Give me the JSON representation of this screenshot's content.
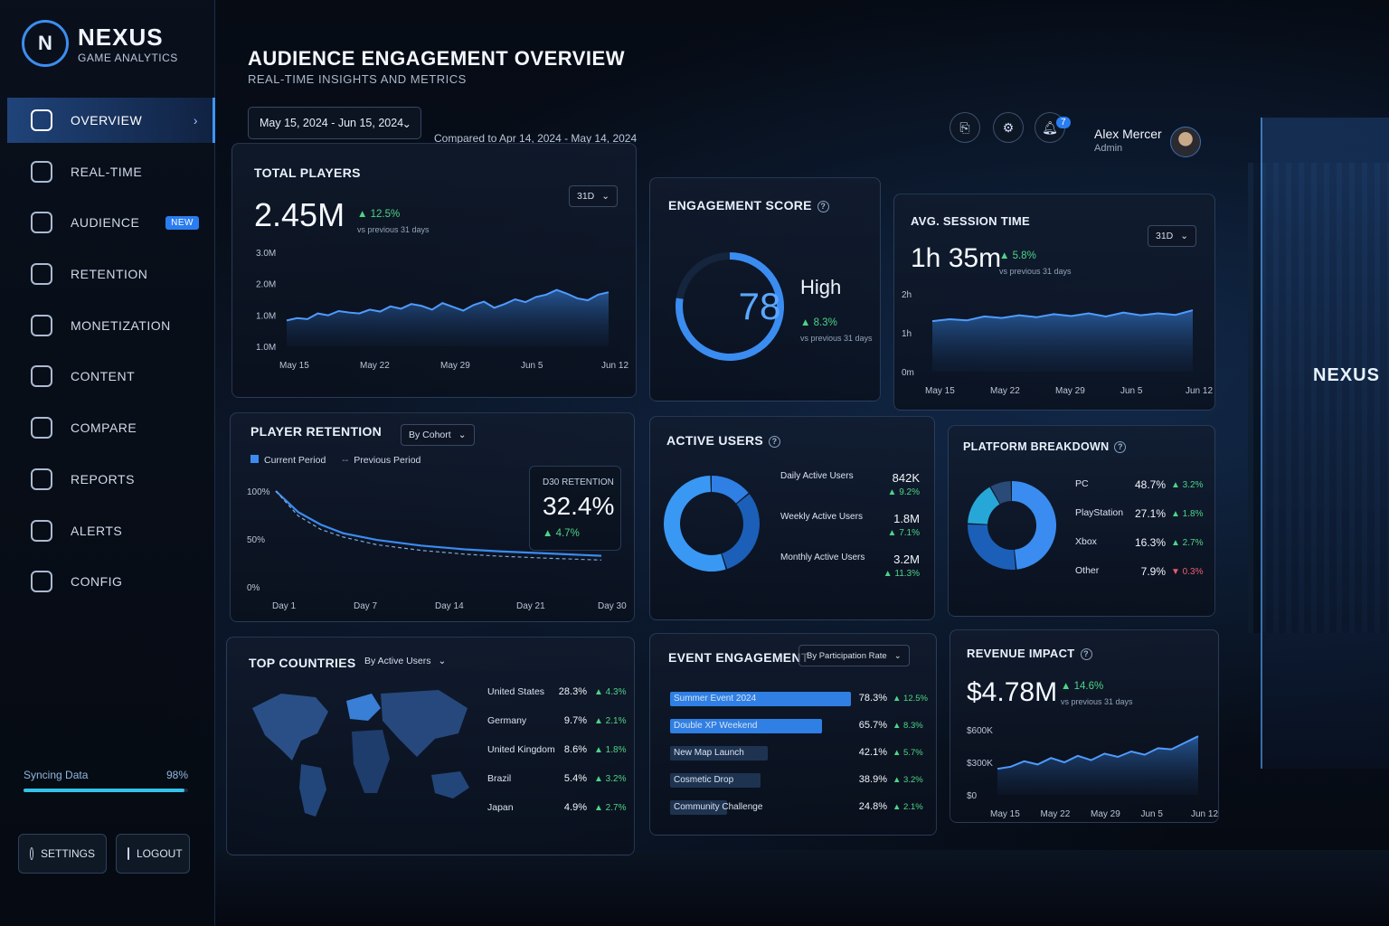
{
  "brand": {
    "name": "NEXUS",
    "sub": "GAME ANALYTICS"
  },
  "nav": [
    {
      "label": "OVERVIEW",
      "icon": "home-icon",
      "active": true
    },
    {
      "label": "REAL-TIME",
      "icon": "realtime-icon"
    },
    {
      "label": "AUDIENCE",
      "icon": "audience-icon",
      "badge": "NEW"
    },
    {
      "label": "RETENTION",
      "icon": "retention-icon"
    },
    {
      "label": "MONETIZATION",
      "icon": "monetization-icon"
    },
    {
      "label": "CONTENT",
      "icon": "content-icon"
    },
    {
      "label": "COMPARE",
      "icon": "compare-icon"
    },
    {
      "label": "REPORTS",
      "icon": "reports-icon"
    },
    {
      "label": "ALERTS",
      "icon": "alerts-icon"
    },
    {
      "label": "CONFIG",
      "icon": "config-icon"
    }
  ],
  "sync": {
    "label": "Syncing Data",
    "pct": "98%",
    "value": 0.98
  },
  "footer": {
    "settings": "SETTINGS",
    "logout": "LOGOUT"
  },
  "header": {
    "title": "AUDIENCE ENGAGEMENT OVERVIEW",
    "subtitle": "REAL-TIME INSIGHTS AND METRICS",
    "date_range": "May 15, 2024 - Jun 15, 2024",
    "compare": "Compared to Apr 14, 2024 - May 14, 2024",
    "notifications": "7",
    "user_name": "Alex Mercer",
    "user_role": "Admin"
  },
  "total_players": {
    "title": "TOTAL PLAYERS",
    "value": "2.45M",
    "delta": "▲ 12.5%",
    "delta_sub": "vs previous 31 days",
    "range": "31D",
    "y_ticks": [
      "3.0M",
      "2.0M",
      "1.0M",
      "1.0M"
    ],
    "x_ticks": [
      "May 15",
      "May 22",
      "May 29",
      "Jun 5",
      "Jun 12"
    ]
  },
  "engagement": {
    "title": "ENGAGEMENT SCORE",
    "score": "78",
    "level": "High",
    "delta": "▲ 8.3%",
    "delta_sub": "vs previous 31 days",
    "value": 78,
    "max": 100
  },
  "session": {
    "title": "AVG. SESSION TIME",
    "value": "1h 35m",
    "delta": "▲ 5.8%",
    "delta_sub": "vs previous 31 days",
    "range": "31D",
    "y_ticks": [
      "2h",
      "1h",
      "0m"
    ],
    "x_ticks": [
      "May 15",
      "May 22",
      "May 29",
      "Jun 5",
      "Jun 12"
    ]
  },
  "retention": {
    "title": "PLAYER RETENTION",
    "filter": "By Cohort",
    "legend_current": "Current Period",
    "legend_previous": "Previous Period",
    "d30_label": "D30 RETENTION",
    "d30_value": "32.4%",
    "d30_delta": "▲ 4.7%",
    "y_ticks": [
      "100%",
      "50%",
      "0%"
    ],
    "x_ticks": [
      "Day 1",
      "Day 7",
      "Day 14",
      "Day 21",
      "Day 30"
    ]
  },
  "active_users": {
    "title": "ACTIVE USERS",
    "rows": [
      {
        "label": "Daily Active Users",
        "value": "842K",
        "delta": "▲ 9.2%"
      },
      {
        "label": "Weekly Active Users",
        "value": "1.8M",
        "delta": "▲ 7.1%"
      },
      {
        "label": "Monthly Active Users",
        "value": "3.2M",
        "delta": "▲ 11.3%"
      }
    ]
  },
  "platform": {
    "title": "PLATFORM BREAKDOWN",
    "rows": [
      {
        "label": "PC",
        "value": "48.7%",
        "delta": "▲ 3.2%",
        "color": "#3b8cf0"
      },
      {
        "label": "PlayStation",
        "value": "27.1%",
        "delta": "▲ 1.8%",
        "color": "#1c5fb8"
      },
      {
        "label": "Xbox",
        "value": "16.3%",
        "delta": "▲ 2.7%",
        "color": "#27a7d8"
      },
      {
        "label": "Other",
        "value": "7.9%",
        "delta": "▼ 0.3%",
        "color": "#2a4a78",
        "negative": true
      }
    ]
  },
  "countries": {
    "title": "TOP COUNTRIES",
    "filter": "By Active Users",
    "rows": [
      {
        "label": "United States",
        "value": "28.3%",
        "delta": "▲ 4.3%"
      },
      {
        "label": "Germany",
        "value": "9.7%",
        "delta": "▲ 2.1%"
      },
      {
        "label": "United Kingdom",
        "value": "8.6%",
        "delta": "▲ 1.8%"
      },
      {
        "label": "Brazil",
        "value": "5.4%",
        "delta": "▲ 3.2%"
      },
      {
        "label": "Japan",
        "value": "4.9%",
        "delta": "▲ 2.7%"
      }
    ]
  },
  "events": {
    "title": "EVENT ENGAGEMENT",
    "filter": "By Participation Rate",
    "rows": [
      {
        "label": "Summer Event 2024",
        "value": "78.3%",
        "delta": "▲ 12.5%",
        "v": 78.3
      },
      {
        "label": "Double XP Weekend",
        "value": "65.7%",
        "delta": "▲ 8.3%",
        "v": 65.7
      },
      {
        "label": "New Map Launch",
        "value": "42.1%",
        "delta": "▲ 5.7%",
        "v": 42.1
      },
      {
        "label": "Cosmetic Drop",
        "value": "38.9%",
        "delta": "▲ 3.2%",
        "v": 38.9
      },
      {
        "label": "Community Challenge",
        "value": "24.8%",
        "delta": "▲ 2.1%",
        "v": 24.8
      }
    ]
  },
  "revenue": {
    "title": "REVENUE IMPACT",
    "value": "$4.78M",
    "delta": "▲ 14.6%",
    "delta_sub": "vs previous 31 days",
    "y_ticks": [
      "$600K",
      "$300K",
      "$0"
    ],
    "x_ticks": [
      "May 15",
      "May 22",
      "May 29",
      "Jun 5",
      "Jun 12"
    ]
  },
  "promo": {
    "text": "NEXUS"
  },
  "chart_data": [
    {
      "type": "area",
      "title": "TOTAL PLAYERS",
      "ylim": [
        1.0,
        3.0
      ],
      "y_unit": "M",
      "x": [
        "May 15",
        "May 16",
        "May 17",
        "May 18",
        "May 19",
        "May 20",
        "May 21",
        "May 22",
        "May 23",
        "May 24",
        "May 25",
        "May 26",
        "May 27",
        "May 28",
        "May 29",
        "May 30",
        "May 31",
        "Jun 1",
        "Jun 2",
        "Jun 3",
        "Jun 4",
        "Jun 5",
        "Jun 6",
        "Jun 7",
        "Jun 8",
        "Jun 9",
        "Jun 10",
        "Jun 11",
        "Jun 12",
        "Jun 13",
        "Jun 14",
        "Jun 15"
      ],
      "values": [
        1.55,
        1.6,
        1.58,
        1.7,
        1.66,
        1.75,
        1.72,
        1.7,
        1.78,
        1.74,
        1.85,
        1.8,
        1.9,
        1.86,
        1.78,
        1.92,
        1.84,
        1.76,
        1.88,
        1.95,
        1.82,
        1.9,
        2.0,
        1.94,
        2.05,
        2.1,
        2.2,
        2.12,
        2.02,
        1.98,
        2.1,
        2.15
      ]
    },
    {
      "type": "area",
      "title": "AVG. SESSION TIME",
      "ylim": [
        0,
        2
      ],
      "y_unit": "h",
      "x": [
        "May 15",
        "May 17",
        "May 19",
        "May 21",
        "May 23",
        "May 25",
        "May 27",
        "May 29",
        "May 31",
        "Jun 2",
        "Jun 4",
        "Jun 6",
        "Jun 8",
        "Jun 10",
        "Jun 12",
        "Jun 14"
      ],
      "values": [
        1.3,
        1.35,
        1.32,
        1.42,
        1.38,
        1.45,
        1.4,
        1.48,
        1.43,
        1.5,
        1.42,
        1.52,
        1.45,
        1.5,
        1.46,
        1.58
      ]
    },
    {
      "type": "line",
      "title": "PLAYER RETENTION",
      "ylim": [
        0,
        100
      ],
      "x": [
        1,
        3,
        5,
        7,
        10,
        14,
        18,
        21,
        25,
        30
      ],
      "series": [
        {
          "name": "Current Period",
          "values": [
            100,
            78,
            65,
            56,
            49,
            43,
            39,
            37,
            35,
            32.4
          ]
        },
        {
          "name": "Previous Period",
          "values": [
            100,
            74,
            60,
            52,
            44,
            38,
            34,
            32,
            30,
            28
          ]
        }
      ]
    },
    {
      "type": "pie",
      "title": "ENGAGEMENT SCORE",
      "categories": [
        "Score",
        "Remaining"
      ],
      "values": [
        78,
        22
      ]
    },
    {
      "type": "pie",
      "title": "ACTIVE USERS",
      "categories": [
        "Daily Active Users",
        "Weekly Active Users",
        "Monthly Active Users"
      ],
      "values": [
        842,
        1800,
        3200
      ]
    },
    {
      "type": "pie",
      "title": "PLATFORM BREAKDOWN",
      "categories": [
        "PC",
        "PlayStation",
        "Xbox",
        "Other"
      ],
      "values": [
        48.7,
        27.1,
        16.3,
        7.9
      ]
    },
    {
      "type": "bar",
      "title": "EVENT ENGAGEMENT",
      "categories": [
        "Summer Event 2024",
        "Double XP Weekend",
        "New Map Launch",
        "Cosmetic Drop",
        "Community Challenge"
      ],
      "values": [
        78.3,
        65.7,
        42.1,
        38.9,
        24.8
      ],
      "ylim": [
        0,
        100
      ]
    },
    {
      "type": "area",
      "title": "REVENUE IMPACT",
      "ylim": [
        0,
        600
      ],
      "y_unit": "K",
      "x": [
        "May 15",
        "May 17",
        "May 19",
        "May 21",
        "May 23",
        "May 25",
        "May 27",
        "May 29",
        "May 31",
        "Jun 2",
        "Jun 4",
        "Jun 6",
        "Jun 8",
        "Jun 10",
        "Jun 12",
        "Jun 14"
      ],
      "values": [
        240,
        260,
        310,
        280,
        340,
        300,
        360,
        320,
        380,
        350,
        400,
        370,
        430,
        420,
        480,
        540
      ]
    }
  ]
}
